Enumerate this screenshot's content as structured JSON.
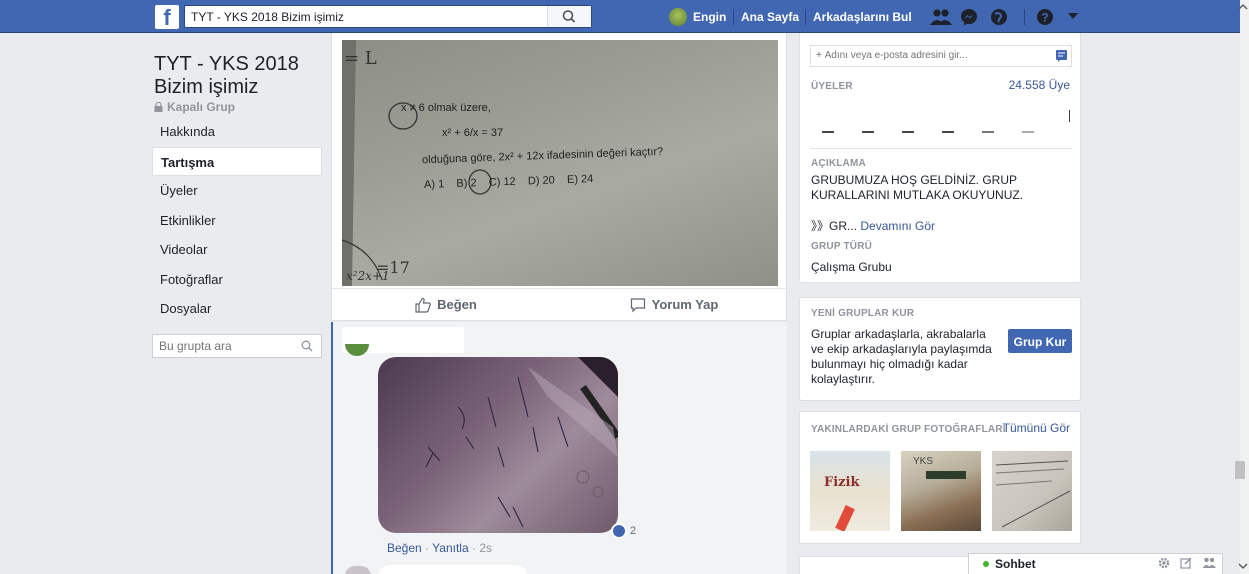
{
  "topbar": {
    "search_value": "TYT - YKS 2018 Bizim işimiz",
    "user_name": "Engin",
    "home": "Ana Sayfa",
    "find_friends": "Arkadaşlarını Bul"
  },
  "group": {
    "title": "TYT - YKS 2018 Bizim işimiz",
    "privacy": "Kapalı Grup",
    "nav": [
      "Hakkında",
      "Tartışma",
      "Üyeler",
      "Etkinlikler",
      "Videolar",
      "Fotoğraflar",
      "Dosyalar"
    ],
    "search_placeholder": "Bu grupta ara"
  },
  "post": {
    "question_lines": [
      "x ≠ 6 olmak üzere,",
      "x² + 6/x = 37",
      "olduğuna göre, 2x² + 12x ifadesinin değeri kaçtır?",
      "A) 1    B) 2    C) 12    D) 20    E) 24"
    ],
    "like_label": "Beğen",
    "comment_label": "Yorum Yap"
  },
  "comment": {
    "reaction_count": "2",
    "like": "Beğen",
    "reply": "Yanıtla",
    "time": "2s"
  },
  "sidebar": {
    "add_member_placeholder": "Adını veya e-posta adresini gir...",
    "members_label": "ÜYELER",
    "members_count": "24.558 Üye",
    "description_label": "AÇIKLAMA",
    "description": "GRUBUMUZA HOŞ GELDİNİZ. GRUP KURALLARINI MUTLAKA OKUYUNUZ.",
    "description_more_prefix": "》》GR...",
    "see_more": "Devamını Gör",
    "group_type_label": "GRUP TÜRÜ",
    "group_type": "Çalışma Grubu",
    "new_groups_label": "YENİ GRUPLAR KUR",
    "new_groups_text": "Gruplar arkadaşlarla, akrabalarla ve ekip arkadaşlarıyla paylaşımda bulunmayı hiç olmadığı kadar kolaylaştırır.",
    "create_group": "Grup Kur",
    "nearby_photos_label": "YAKINLARDAKİ GRUP FOTOĞRAFLARI",
    "see_all": "Tümünü Gör",
    "photo1_text": "Fizik",
    "photo2_text": "YKS"
  },
  "chat": {
    "label": "Sohbet"
  },
  "colors": {
    "brand": "#4267b2",
    "link": "#385898",
    "background": "#e9ebee"
  }
}
